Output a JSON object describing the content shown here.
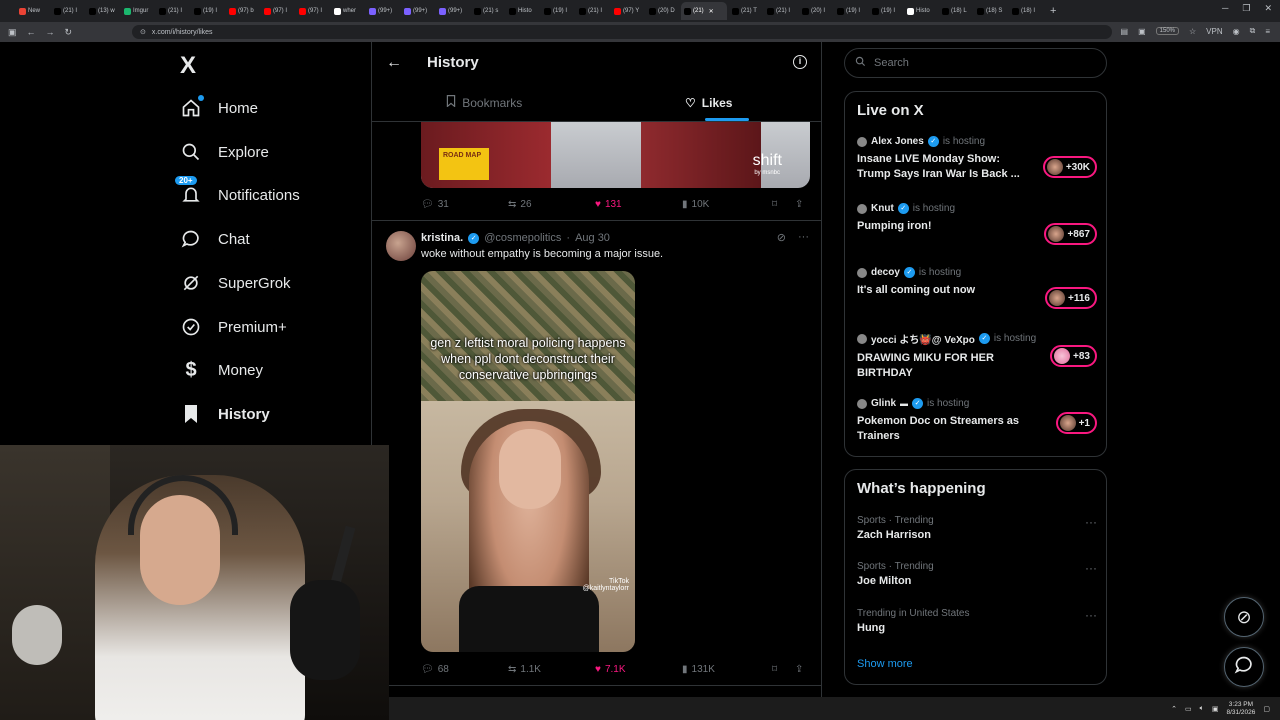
{
  "browser": {
    "tabs": [
      {
        "label": "New",
        "color": "#ea4335"
      },
      {
        "label": "(21) I",
        "color": "#000000"
      },
      {
        "label": "(13) w",
        "color": "#000000"
      },
      {
        "label": "Imgur",
        "color": "#1bb76e"
      },
      {
        "label": "(21) I",
        "color": "#000000"
      },
      {
        "label": "(19) I",
        "color": "#000000"
      },
      {
        "label": "(97) b",
        "color": "#ff0000"
      },
      {
        "label": "(97) I",
        "color": "#ff0000"
      },
      {
        "label": "(97) I",
        "color": "#ff0000"
      },
      {
        "label": "wher",
        "color": "#ffffff"
      },
      {
        "label": "(99+)",
        "color": "#7b61ff"
      },
      {
        "label": "(99+)",
        "color": "#7b61ff"
      },
      {
        "label": "(99+)",
        "color": "#7b61ff"
      },
      {
        "label": "(21) s",
        "color": "#000000"
      },
      {
        "label": "Histo",
        "color": "#000000"
      },
      {
        "label": "(19) I",
        "color": "#000000"
      },
      {
        "label": "(21) I",
        "color": "#000000"
      },
      {
        "label": "(97) Y",
        "color": "#ff0000"
      },
      {
        "label": "(20) D",
        "color": "#000000"
      },
      {
        "label": "(21)",
        "color": "#000000",
        "active": true
      },
      {
        "label": "(21) T",
        "color": "#000000"
      },
      {
        "label": "(21) I",
        "color": "#000000"
      },
      {
        "label": "(20) I",
        "color": "#000000"
      },
      {
        "label": "(19) I",
        "color": "#000000"
      },
      {
        "label": "(19) I",
        "color": "#000000"
      },
      {
        "label": "Histo",
        "color": "#ffffff"
      },
      {
        "label": "(18) L",
        "color": "#000000"
      },
      {
        "label": "(18) S",
        "color": "#000000"
      },
      {
        "label": "(18) I",
        "color": "#000000"
      }
    ],
    "url": "x.com/i/history/likes",
    "zoom": "150%",
    "vpn": "VPN"
  },
  "sidebar": {
    "logo": "X",
    "items": [
      {
        "label": "Home",
        "icon": "home-icon"
      },
      {
        "label": "Explore",
        "icon": "search-icon"
      },
      {
        "label": "Notifications",
        "icon": "bell-icon",
        "badge": "20+"
      },
      {
        "label": "Chat",
        "icon": "chat-icon"
      },
      {
        "label": "SuperGrok",
        "icon": "grok-icon"
      },
      {
        "label": "Premium+",
        "icon": "premium-icon"
      },
      {
        "label": "Money",
        "icon": "money-icon"
      },
      {
        "label": "History",
        "icon": "bookmark-icon",
        "active": true
      }
    ]
  },
  "main": {
    "title": "History",
    "tabs": [
      {
        "label": "Bookmarks",
        "icon": "bookmark-icon"
      },
      {
        "label": "Likes",
        "icon": "heart-icon",
        "active": true
      }
    ],
    "media1": {
      "roadmap": "ROAD MAP",
      "shift": "shift",
      "network": "by msnbc"
    },
    "post1_stats": {
      "replies": "31",
      "reposts": "26",
      "likes": "131",
      "views": "10K"
    },
    "post2": {
      "name": "kristina.",
      "handle": "@cosmepolitics",
      "date": "Aug 30",
      "text": "woke without empathy is becoming a major issue.",
      "overlay": "gen z leftist moral policing happens when ppl dont deconstruct their conservative upbringings",
      "watermark": "TikTok",
      "watermark_user": "@kaitlyntaylorr",
      "stats": {
        "replies": "68",
        "reposts": "1.1K",
        "likes": "7.1K",
        "views": "131K"
      }
    }
  },
  "right": {
    "search_placeholder": "Search",
    "live_title": "Live on X",
    "live": [
      {
        "host": "Alex Jones",
        "status": "is hosting",
        "title": "Insane LIVE Monday Show: Trump Says Iran War Is Back ...",
        "count": "+30K"
      },
      {
        "host": "Knut",
        "status": "is hosting",
        "title": "Pumping iron!",
        "count": "+867"
      },
      {
        "host": "decoy",
        "status": "is hosting",
        "title": "It's all coming out now",
        "count": "+116"
      },
      {
        "host": "yocci よち👹@ VeXpo",
        "status": "is hosting",
        "title": "DRAWING MIKU FOR HER BIRTHDAY",
        "count": "+83"
      },
      {
        "host": "Glink",
        "status": "is hosting",
        "title": "Pokemon Doc on Streamers as Trainers",
        "count": "+1"
      }
    ],
    "happening_title": "What’s happening",
    "trends": [
      {
        "category": "Sports · Trending",
        "name": "Zach Harrison"
      },
      {
        "category": "Sports · Trending",
        "name": "Joe Milton"
      },
      {
        "category": "Trending in United States",
        "name": "Hung"
      }
    ],
    "show_more": "Show more"
  },
  "taskbar": {
    "time": "3:23 PM",
    "date": "8/31/2026"
  }
}
